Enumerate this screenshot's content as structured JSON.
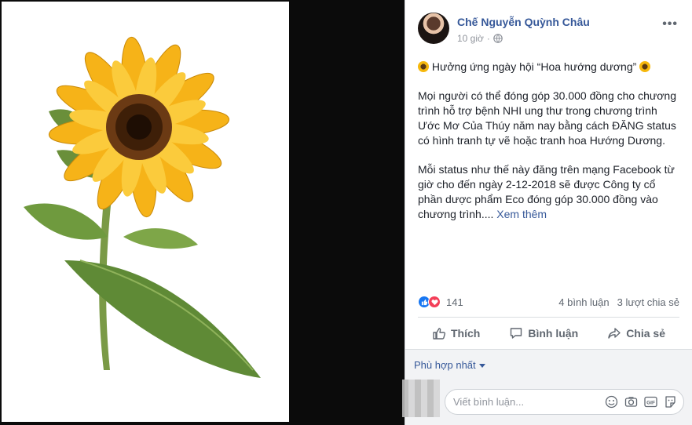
{
  "post": {
    "author": "Chế Nguyễn Quỳnh Châu",
    "time": "10 giờ",
    "more": "•••",
    "body": [
      "Hưởng ứng ngày hội “Hoa hướng dương”",
      "Mọi người có thể đóng góp 30.000 đồng cho chương trình hỗ trợ bệnh NHI ung thư trong chương trình Ước Mơ Của Thúy năm nay bằng cách ĐĂNG status có hình tranh tự vẽ hoặc tranh hoa Hướng Dương.",
      "Mỗi status như thế này đăng trên mạng Facebook từ giờ cho đến ngày 2-12-2018 sẽ được Công ty cổ phần dược phẩm Eco đóng góp 30.000 đồng vào chương trình...."
    ],
    "see_more": "Xem thêm"
  },
  "reactions": {
    "count": "141",
    "comments": "4 bình luận",
    "shares": "3 lượt chia sẻ"
  },
  "actions": {
    "like": "Thích",
    "comment": "Bình luận",
    "share": "Chia sẻ"
  },
  "comments": {
    "sort_label": "Phù hợp nhất",
    "placeholder": "Viết bình luận...",
    "gif_label": "GIF"
  },
  "icons": [
    "globe-icon",
    "like-reaction-icon",
    "love-reaction-icon",
    "like-icon",
    "comment-icon",
    "share-icon",
    "emoji-icon",
    "camera-icon",
    "gif-icon",
    "sticker-icon"
  ],
  "colors": {
    "link": "#365899",
    "muted": "#90949c",
    "text": "#1d2129",
    "like": "#1877f2",
    "love": "#f33e58"
  }
}
